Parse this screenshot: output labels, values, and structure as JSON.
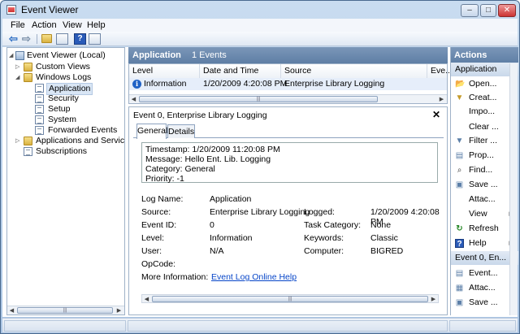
{
  "window": {
    "title": "Event Viewer",
    "minimize_glyph": "–",
    "maximize_glyph": "□",
    "close_glyph": "✕"
  },
  "menubar": {
    "items": [
      "File",
      "Action",
      "View",
      "Help"
    ]
  },
  "toolbar": {
    "back_icon": "arrow-left-icon",
    "forward_icon": "arrow-right-icon",
    "back_glyph": "⇦",
    "forward_glyph": "⇨",
    "help_glyph": "?"
  },
  "tree": {
    "root": "Event Viewer (Local)",
    "custom_views": "Custom Views",
    "windows_logs": "Windows Logs",
    "application": "Application",
    "security": "Security",
    "setup": "Setup",
    "system": "System",
    "forwarded_events": "Forwarded Events",
    "apps_services": "Applications and Services Lo",
    "subscriptions": "Subscriptions",
    "expanded_glyph": "◢",
    "collapsed_glyph": "▷"
  },
  "log_header": {
    "title": "Application",
    "count": "1 Events"
  },
  "grid": {
    "columns": [
      "Level",
      "Date and Time",
      "Source",
      "Eve..."
    ],
    "rows": [
      {
        "level": "Information",
        "datetime": "1/20/2009 4:20:08 PM",
        "source": "Enterprise Library Logging"
      }
    ],
    "info_glyph": "i"
  },
  "detail": {
    "title": "Event 0, Enterprise Library Logging",
    "close_glyph": "✕",
    "tabs": [
      "General",
      "Details"
    ],
    "message_lines": [
      "Timestamp: 1/20/2009 11:20:08 PM",
      "Message: Hello Ent. Lib. Logging",
      "Category: General",
      "Priority: -1"
    ],
    "props": {
      "log_name_label": "Log Name:",
      "log_name": "Application",
      "source_label": "Source:",
      "source": "Enterprise Library Logging",
      "logged_label": "Logged:",
      "logged": "1/20/2009 4:20:08 PM",
      "event_id_label": "Event ID:",
      "event_id": "0",
      "task_category_label": "Task Category:",
      "task_category": "None",
      "level_label": "Level:",
      "level": "Information",
      "keywords_label": "Keywords:",
      "keywords": "Classic",
      "user_label": "User:",
      "user": "N/A",
      "computer_label": "Computer:",
      "computer": "BIGRED",
      "opcode_label": "OpCode:",
      "more_info_label": "More Information:",
      "more_info_link": "Event Log Online Help"
    }
  },
  "actions": {
    "title": "Actions",
    "section1": "Application",
    "section2": "Event 0, En...",
    "items1": [
      {
        "label": "Open...",
        "icon": "open-folder-icon",
        "glyph": "📂"
      },
      {
        "label": "Creat...",
        "icon": "filter-icon",
        "glyph": "▼"
      },
      {
        "label": "Impo...",
        "icon": "",
        "glyph": ""
      },
      {
        "label": "Clear ...",
        "icon": "",
        "glyph": ""
      },
      {
        "label": "Filter ...",
        "icon": "filter-icon",
        "glyph": "▼"
      },
      {
        "label": "Prop...",
        "icon": "properties-icon",
        "glyph": "▤"
      },
      {
        "label": "Find...",
        "icon": "find-icon",
        "glyph": "⌕"
      },
      {
        "label": "Save ...",
        "icon": "save-icon",
        "glyph": "▣"
      },
      {
        "label": "Attac...",
        "icon": "",
        "glyph": ""
      },
      {
        "label": "View",
        "icon": "",
        "glyph": ""
      },
      {
        "label": "Refresh",
        "icon": "refresh-icon",
        "glyph": "↻"
      },
      {
        "label": "Help",
        "icon": "help-icon",
        "glyph": "?"
      }
    ],
    "items2": [
      {
        "label": "Event...",
        "icon": "event-properties-icon",
        "glyph": "▤"
      },
      {
        "label": "Attac...",
        "icon": "attach-task-icon",
        "glyph": "▦"
      },
      {
        "label": "Save ...",
        "icon": "save-icon",
        "glyph": "▣"
      }
    ],
    "caret_up": "▲",
    "submenu_glyph": "▶"
  },
  "scroll": {
    "left_glyph": "◀",
    "right_glyph": "▶",
    "thumb_glyph": "|||"
  }
}
